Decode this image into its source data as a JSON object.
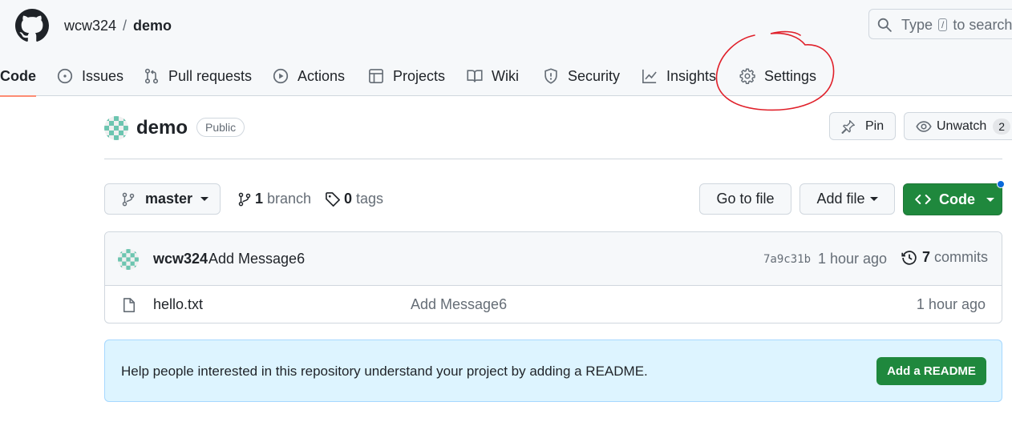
{
  "header": {
    "owner": "wcw324",
    "separator": "/",
    "repo": "demo",
    "search": {
      "before": "Type",
      "key": "/",
      "after": "to search"
    }
  },
  "tabs": [
    {
      "label": "Code",
      "icon": "code-icon",
      "active": true
    },
    {
      "label": "Issues",
      "icon": "issue-opened-icon"
    },
    {
      "label": "Pull requests",
      "icon": "git-pull-request-icon"
    },
    {
      "label": "Actions",
      "icon": "play-icon"
    },
    {
      "label": "Projects",
      "icon": "table-icon"
    },
    {
      "label": "Wiki",
      "icon": "book-icon"
    },
    {
      "label": "Security",
      "icon": "shield-icon"
    },
    {
      "label": "Insights",
      "icon": "graph-icon"
    },
    {
      "label": "Settings",
      "icon": "gear-icon"
    }
  ],
  "repo": {
    "name": "demo",
    "visibility": "Public",
    "pin_label": "Pin",
    "watch_label": "Unwatch",
    "watch_count": "2"
  },
  "branch_bar": {
    "branch": "master",
    "branch_count": "1",
    "branch_word": "branch",
    "tag_count": "0",
    "tag_word": "tags",
    "goto_file": "Go to file",
    "add_file": "Add file",
    "code_button": "Code"
  },
  "latest_commit": {
    "author": "wcw324",
    "message": "Add Message6",
    "sha": "7a9c31b",
    "time": "1 hour ago",
    "commit_count": "7",
    "commit_word": "commits"
  },
  "files": [
    {
      "name": "hello.txt",
      "message": "Add Message6",
      "time": "1 hour ago"
    }
  ],
  "readme_banner": {
    "text": "Help people interested in this repository understand your project by adding a README.",
    "button": "Add a README"
  },
  "colors": {
    "primary_green": "#1f883d",
    "active_tab_underline": "#fd8c73",
    "annotation_red": "#e0202a",
    "banner_bg": "#ddf4ff",
    "notification_dot": "#0969da"
  }
}
